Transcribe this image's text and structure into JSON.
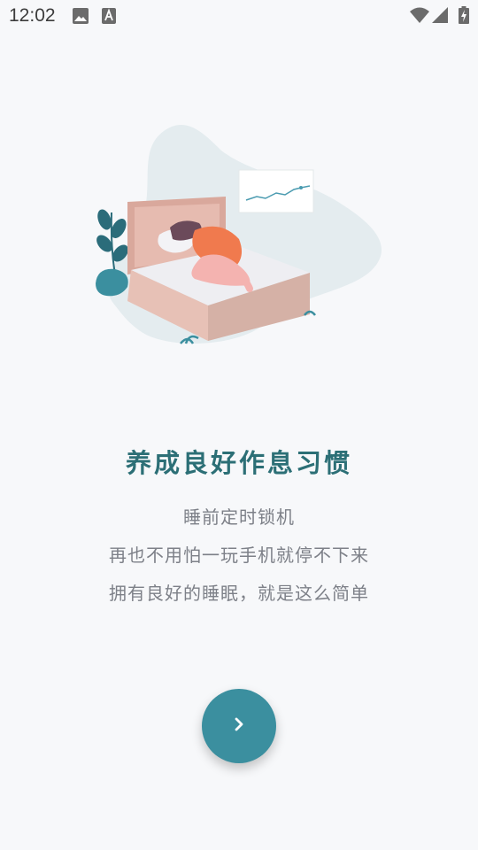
{
  "status_bar": {
    "time": "12:02",
    "icons": [
      "image-icon",
      "keyboard-a-icon",
      "wifi-icon",
      "signal-icon",
      "battery-charging-icon"
    ]
  },
  "illustration": {
    "subject": "woman sleeping on bed icon",
    "colors": {
      "blob": "#e4ecef",
      "bed_frame": "#d9a89c",
      "shirt": "#f07a4e",
      "plant": "#2b6c7a"
    }
  },
  "onboarding": {
    "headline": "养成良好作息习惯",
    "lines": [
      "睡前定时锁机",
      "再也不用怕一玩手机就停不下来",
      "拥有良好的睡眠，就是这么简单"
    ]
  },
  "next_button": {
    "icon": "chevron-right-icon",
    "color": "#3b8f9f"
  }
}
